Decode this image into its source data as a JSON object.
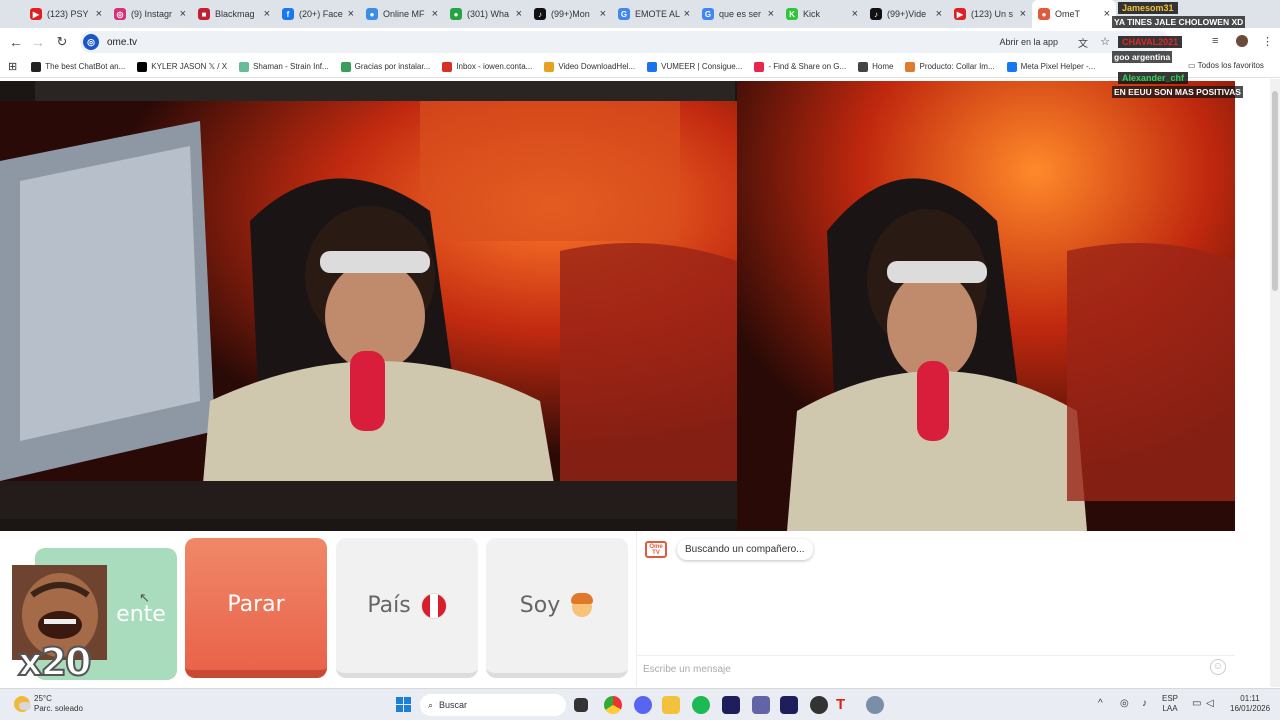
{
  "tabs": [
    {
      "label": "(123) PSY",
      "color": "#e02020",
      "glyph": "▶"
    },
    {
      "label": "(9) Instagr",
      "color": "#d6307a",
      "glyph": "◎"
    },
    {
      "label": "Blackmag",
      "color": "#c42034",
      "glyph": "■"
    },
    {
      "label": "(20+) Face",
      "color": "#1877f2",
      "glyph": "f"
    },
    {
      "label": "Online MF",
      "color": "#3a8ee6",
      "glyph": "●"
    },
    {
      "label": "(301) Wha",
      "color": "#25a243",
      "glyph": "●"
    },
    {
      "label": "(99+)Mon",
      "color": "#111111",
      "glyph": "♪"
    },
    {
      "label": "EMOTE AL",
      "color": "#4285f4",
      "glyph": "G"
    },
    {
      "label": "que es ser",
      "color": "#4285f4",
      "glyph": "G"
    },
    {
      "label": "Kick",
      "color": "#34c43c",
      "glyph": "K"
    },
    {
      "label": "(99+)Vide",
      "color": "#111111",
      "glyph": "♪"
    },
    {
      "label": "(123) Un s",
      "color": "#e02020",
      "glyph": "▶"
    },
    {
      "label": "OmeT",
      "color": "#e05a3e",
      "glyph": "●",
      "active": true
    }
  ],
  "toolbar": {
    "url": "ome.tv",
    "open_app": "Abrir en la app"
  },
  "bookmarks": [
    {
      "label": "The best ChatBot an...",
      "color": "#222"
    },
    {
      "label": "KYLER JASON 𝕏 / X",
      "color": "#000"
    },
    {
      "label": "Shaman - Strain Inf...",
      "color": "#6b9"
    },
    {
      "label": "Gracias por instalar...",
      "color": "#3a9d5d"
    },
    {
      "label": "Inbox - iowen.conta...",
      "color": "#d93025"
    },
    {
      "label": "Video DownloadHel...",
      "color": "#e8a020"
    },
    {
      "label": "VUMEER | Consigue...",
      "color": "#1a73e8"
    },
    {
      "label": "- Find & Share on G...",
      "color": "#e8254a"
    },
    {
      "label": "Home",
      "color": "#444"
    },
    {
      "label": "Producto: Collar Im...",
      "color": "#e07a30"
    },
    {
      "label": "Meta Pixel Helper -...",
      "color": "#1877f2"
    }
  ],
  "bookmarks_all": "Todos los favoritos",
  "controls": {
    "next": "ente",
    "stop": "Parar",
    "country": "País",
    "soy": "Soy"
  },
  "chat": {
    "logo": "Ome TV",
    "status": "Buscando un compañero...",
    "placeholder": "Escribe un mensaje"
  },
  "overlay": {
    "multiplier": "x20",
    "messages": [
      {
        "user": "Jamesom31",
        "user_color": "#f2c035",
        "text": "YA TINES JALE CHOLOWEN XD"
      },
      {
        "user": "CHAVAL2021",
        "user_color": "#e02828",
        "text": "goo argentina"
      },
      {
        "user": "Alexander_chf",
        "user_color": "#34d058",
        "text": "EN EEUU SON MAS POSITIVAS"
      }
    ]
  },
  "taskbar": {
    "temp": "25°C",
    "weather": "Parc. soleado",
    "search": "Buscar",
    "lang1": "ESP",
    "lang2": "LAA",
    "time": "01:11",
    "date": "16/01/2026"
  }
}
